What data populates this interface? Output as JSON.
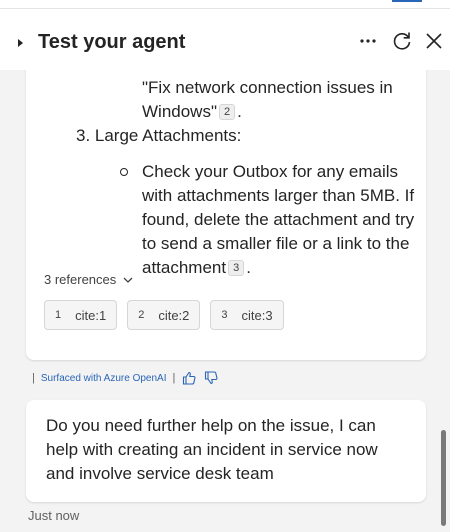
{
  "header": {
    "title": "Test your agent",
    "icons": [
      "chevron-right-icon",
      "more-icon",
      "refresh-icon",
      "close-icon"
    ]
  },
  "message1": {
    "line1": "\"Fix network connection issues in Windows\"",
    "line1_cite": "2",
    "line1_after": ".",
    "item_heading": "3. Large Attachments:",
    "bullet": "Check your Outbox for any emails with attachments larger than 5MB. If found, delete the attachment and try to send a smaller file or a link to the attachment",
    "bullet_cite": "3",
    "bullet_after": ".",
    "references_label": "3 references",
    "references": [
      {
        "num": "1",
        "label": "cite:1"
      },
      {
        "num": "2",
        "label": "cite:2"
      },
      {
        "num": "3",
        "label": "cite:3"
      }
    ]
  },
  "ai_note": {
    "separator": "|",
    "label": "Surfaced with Azure OpenAI",
    "separator2": "|"
  },
  "message2": {
    "text": "Do you need further help on the issue, I can help with creating an incident in service now and involve service desk team",
    "timestamp": "Just now"
  },
  "colors": {
    "accent": "#2a66b8",
    "background": "#f3f3f3",
    "bubble": "#ffffff"
  }
}
